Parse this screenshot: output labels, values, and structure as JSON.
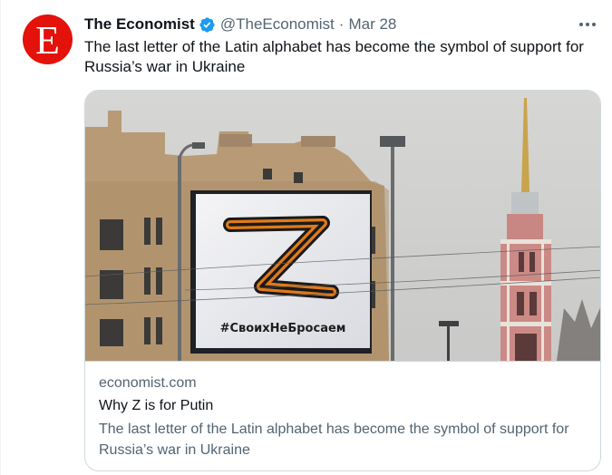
{
  "tweet": {
    "avatar_letter": "E",
    "author_name": "The Economist",
    "handle": "@TheEconomist",
    "separator": "·",
    "date": "Mar 28",
    "text": "The last letter of the Latin alphabet has become the symbol of support for Russia’s war in Ukraine",
    "verified_icon": "verified-badge-icon",
    "more_icon": "more-horizontal-icon"
  },
  "card": {
    "image_caption": "#СвоихНеБросаем",
    "domain": "economist.com",
    "title": "Why Z is for Putin",
    "description": "The last letter of the Latin alphabet has become the symbol of support for Russia’s war in Ukraine"
  },
  "colors": {
    "brand_red": "#e3120b",
    "verified_blue": "#1d9bf0",
    "text_primary": "#0f1419",
    "text_secondary": "#536471",
    "border": "#cfd9de"
  }
}
